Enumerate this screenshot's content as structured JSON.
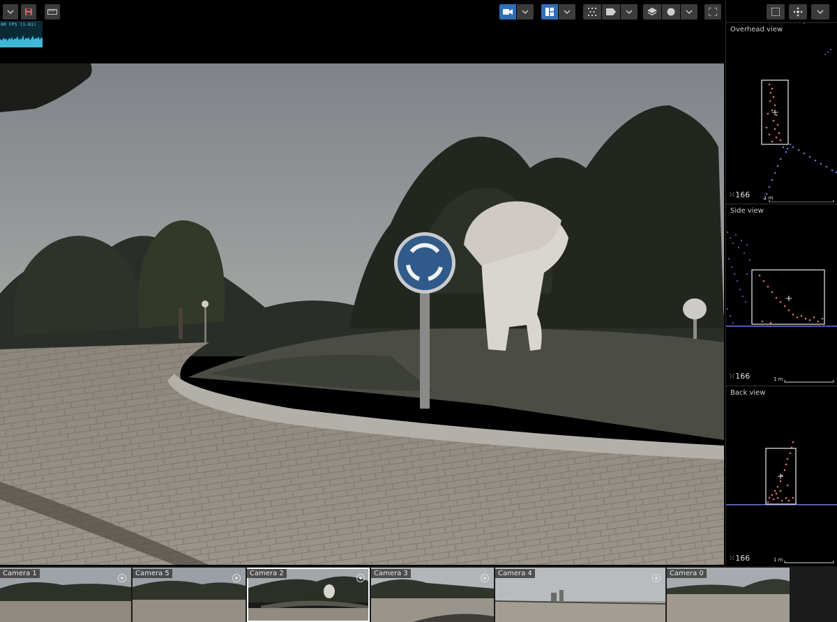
{
  "toolbar": {
    "fps_label": "80 FPS (1-61)",
    "icons": [
      "chevron-down-icon",
      "save-icon",
      "ruler-icon",
      "camera-icon",
      "layout-icon",
      "points-icon",
      "label-icon",
      "layers-icon",
      "circle-icon",
      "fullscreen-icon"
    ],
    "accent_color": "#2f6fb8"
  },
  "right_panel": {
    "views": [
      {
        "title": "Overhead view",
        "count": "166",
        "scale": "1 m"
      },
      {
        "title": "Side view",
        "count": "166",
        "scale": "1 m"
      },
      {
        "title": "Back view",
        "count": "166",
        "scale": "1 m"
      }
    ],
    "point_color": "#e07a6a",
    "ground_color": "#6a78e0"
  },
  "cameras": [
    {
      "label": "Camera 1"
    },
    {
      "label": "Camera 5"
    },
    {
      "label": "Camera 2",
      "selected": true
    },
    {
      "label": "Camera 3"
    },
    {
      "label": "Camera 4"
    },
    {
      "label": "Camera 0"
    }
  ]
}
